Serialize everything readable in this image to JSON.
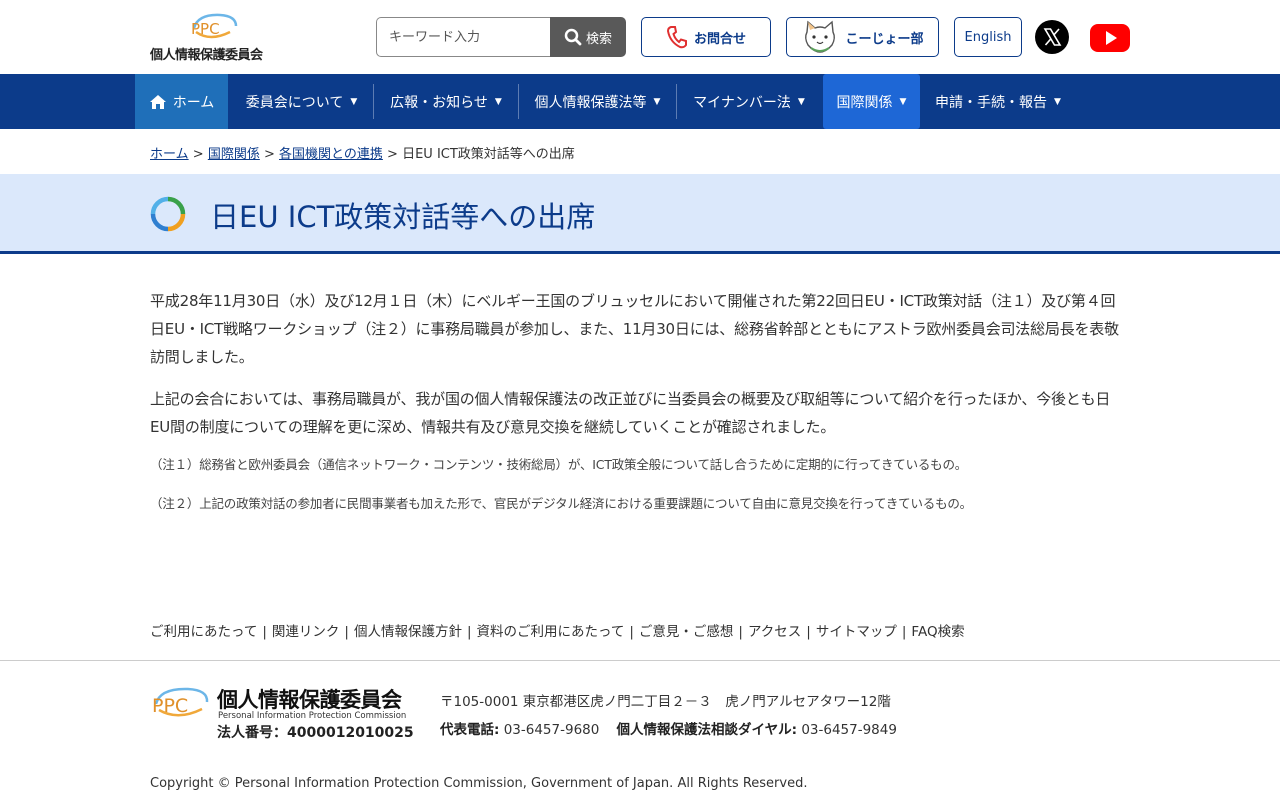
{
  "header": {
    "logo_mark": "PPC",
    "logo_name": "個人情報保護委員会",
    "search_placeholder": "キーワード入力",
    "search_button": "検索",
    "contact_button": "お問合せ",
    "kojo_button": "こーじょー部",
    "english_button": "English"
  },
  "nav": {
    "items": [
      {
        "label": "ホーム"
      },
      {
        "label": "委員会について"
      },
      {
        "label": "広報・お知らせ"
      },
      {
        "label": "個人情報保護法等"
      },
      {
        "label": "マイナンバー法"
      },
      {
        "label": "国際関係"
      },
      {
        "label": "申請・手続・報告"
      }
    ],
    "caret": "▼"
  },
  "breadcrumb": {
    "home": "ホーム",
    "intl": "国際関係",
    "cooperation": "各国機関との連携",
    "sep": ">",
    "current": "日EU ICT政策対話等への出席"
  },
  "page": {
    "title": "日EU ICT政策対話等への出席",
    "paragraphs": [
      "平成28年11月30日（水）及び12月１日（木）にベルギー王国のブリュッセルにおいて開催された第22回日EU・ICT政策対話（注１）及び第４回日EU・ICT戦略ワークショップ（注２）に事務局職員が参加し、また、11月30日には、総務省幹部とともにアストラ欧州委員会司法総局長を表敬訪問しました。",
      "上記の会合においては、事務局職員が、我が国の個人情報保護法の改正並びに当委員会の概要及び取組等について紹介を行ったほか、今後とも日EU間の制度についての理解を更に深め、情報共有及び意見交換を継続していくことが確認されました。"
    ],
    "notes": [
      "（注１）総務省と欧州委員会（通信ネットワーク・コンテンツ・技術総局）が、ICT政策全般について話し合うために定期的に行ってきているもの。",
      "（注２）上記の政策対話の参加者に民間事業者も加えた形で、官民がデジタル経済における重要課題について自由に意見交換を行ってきているもの。"
    ]
  },
  "footer": {
    "links": [
      {
        "label": "ご利用にあたって"
      },
      {
        "label": "関連リンク"
      },
      {
        "label": "個人情報保護方針"
      },
      {
        "label": "資料のご利用にあたって"
      },
      {
        "label": "ご意見・ご感想"
      },
      {
        "label": "アクセス"
      },
      {
        "label": "サイトマップ"
      },
      {
        "label": "FAQ検索"
      }
    ],
    "link_sep": "|",
    "logo_mark": "PPC",
    "org_name": "個人情報保護委員会",
    "org_name_en": "Personal Information Protection Commission",
    "corp_number": "法人番号：4000012010025",
    "address": "〒105-0001 東京都港区虎ノ門二丁目２－３　虎ノ門アルセアタワー12階",
    "tel_label": "代表電話:",
    "tel": "03-6457-9680",
    "dial_label": "個人情報保護法相談ダイヤル:",
    "dial": "03-6457-9849",
    "copyright": "Copyright © Personal Information Protection Commission, Government of Japan. All Rights Reserved."
  },
  "colors": {
    "nav_bg": "#0c3b8a",
    "nav_active": "#1e67d6",
    "title_band": "#dbe8fb",
    "youtube": "#ff0000"
  }
}
